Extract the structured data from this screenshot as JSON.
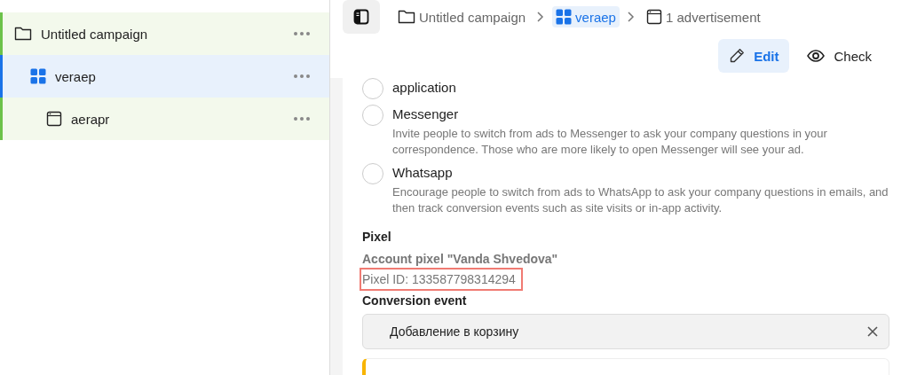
{
  "sidebar": {
    "items": [
      {
        "label": "Untitled campaign",
        "kind": "campaign",
        "selected": false,
        "children": [
          {
            "label": "veraep",
            "kind": "adset",
            "selected": true,
            "children": [
              {
                "label": "aerapr",
                "kind": "ad",
                "selected": false
              }
            ]
          }
        ]
      }
    ]
  },
  "breadcrumbs": [
    {
      "label": "Untitled campaign",
      "kind": "campaign",
      "selected": false
    },
    {
      "label": "veraep",
      "kind": "adset",
      "selected": true
    },
    {
      "label": "1 advertisement",
      "kind": "ad",
      "selected": false
    }
  ],
  "actions": [
    {
      "label": "Edit",
      "kind": "edit",
      "selected": true
    },
    {
      "label": "Check",
      "kind": "check",
      "selected": false
    }
  ],
  "options": [
    {
      "label": "application",
      "selected": false
    },
    {
      "label": "Messenger",
      "description": "Invite people to switch from ads to Messenger to ask your company questions in your correspondence. Those who are more likely to open Messenger will see your ad.",
      "selected": false
    },
    {
      "label": "Whatsapp",
      "description": "Encourage people to switch from ads to WhatsApp to ask your company questions in emails, and then track conversion events such as site visits or in-app activity.",
      "selected": false
    }
  ],
  "pixel": {
    "title": "Pixel",
    "account": "Account pixel \"Vanda Shvedova\"",
    "pixel_id": "Pixel ID: 133587798314294",
    "highlighted": true
  },
  "conversion_event": {
    "label": "Conversion event",
    "value": "Добавление в корзину"
  }
}
